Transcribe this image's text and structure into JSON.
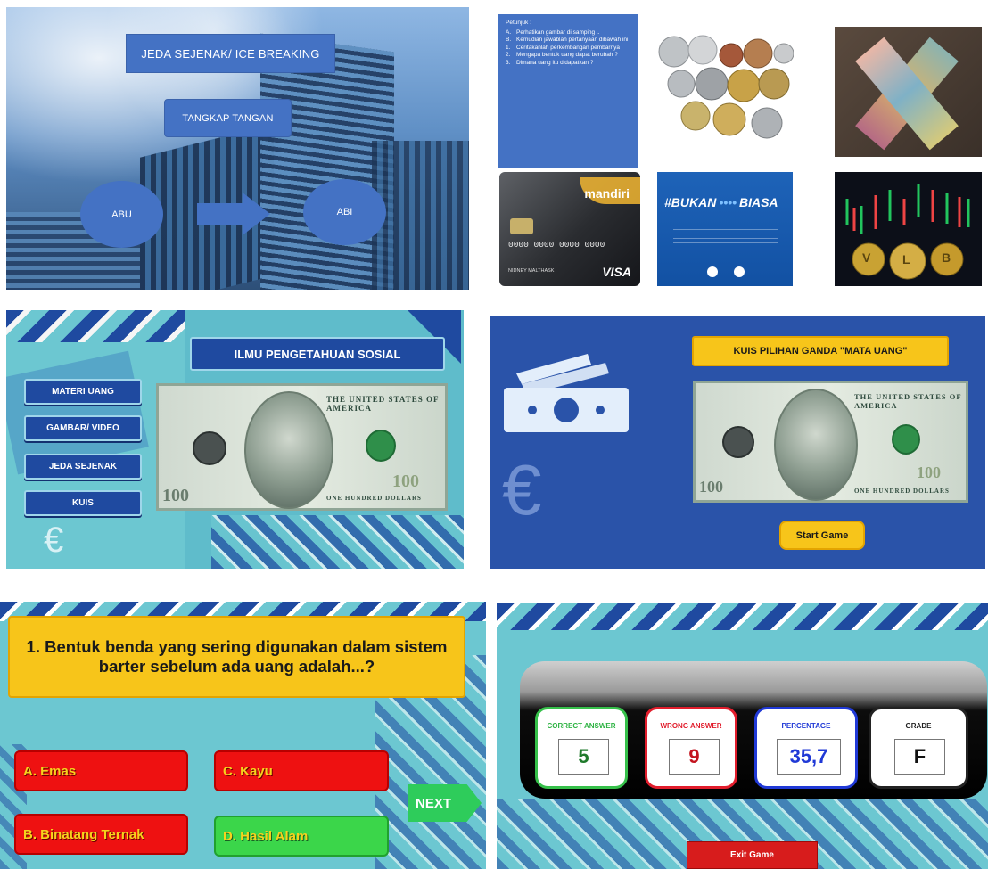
{
  "slide1": {
    "title": "JEDA SEJENAK/ ICE BREAKING",
    "subtitle": "TANGKAP TANGAN",
    "left_circle": "ABU",
    "right_circle": "ABI"
  },
  "slide2": {
    "petunjuk_title": "Petunjuk :",
    "items": [
      "Perhatikan gambar di samping ..",
      "Kemudian jawablah pertanyaan dibawah ini",
      "Ceritakanlah perkembangan pembarnya",
      "Mengapa bentuk uang dapat berubah ?",
      "Dimana uang itu didapatkan ?"
    ],
    "markers": [
      "A.",
      "B.",
      "1.",
      "2.",
      "3."
    ],
    "card_brand": "mandiri",
    "card_number": "0000  0000  0000  0000",
    "card_network": "VISA",
    "card_holder": "NIDNEY MALTHASK",
    "campaign_prefix": "#",
    "campaign_a": "BUKAN",
    "campaign_b": "BIASA",
    "chart_letters": [
      "V",
      "L",
      "B"
    ]
  },
  "slide3": {
    "banner": "ILMU PENGETAHUAN SOSIAL",
    "menu": [
      "MATERI UANG",
      "GAMBAR/ VIDEO",
      "JEDA SEJENAK",
      "KUIS"
    ],
    "currency_symbol": "€",
    "bill_top_text": "THE UNITED STATES OF AMERICA",
    "bill_bottom_text": "ONE HUNDRED DOLLARS",
    "bill_denomination": "100"
  },
  "slide4": {
    "banner": "KUIS PILIHAN GANDA \"MATA UANG\"",
    "start_label": "Start Game",
    "currency_symbol": "€",
    "bill_top_text": "THE UNITED STATES OF AMERICA",
    "bill_bottom_text": "ONE HUNDRED DOLLARS",
    "bill_denomination": "100"
  },
  "slide5": {
    "question": "1. Bentuk benda yang sering digunakan dalam sistem barter sebelum ada uang adalah...?",
    "answers": {
      "a": "A. Emas",
      "b": "B. Binatang Ternak",
      "c": "C. Kayu",
      "d": "D. Hasil Alam"
    },
    "next_label": "NEXT"
  },
  "slide6": {
    "correct_label": "CORRECT ANSWER",
    "correct_value": "5",
    "wrong_label": "WRONG ANSWER",
    "wrong_value": "9",
    "percentage_label": "PERCENTAGE",
    "percentage_value": "35,7",
    "grade_label": "GRADE",
    "grade_value": "F",
    "exit_label": "Exit Game"
  },
  "colors": {
    "slide_blue": "#4472c4",
    "game_teal": "#6cc7d1",
    "banner_yellow": "#f7c51a",
    "answer_red": "#ee1111",
    "answer_green": "#3bd64a",
    "navy": "#1f4aa0"
  }
}
